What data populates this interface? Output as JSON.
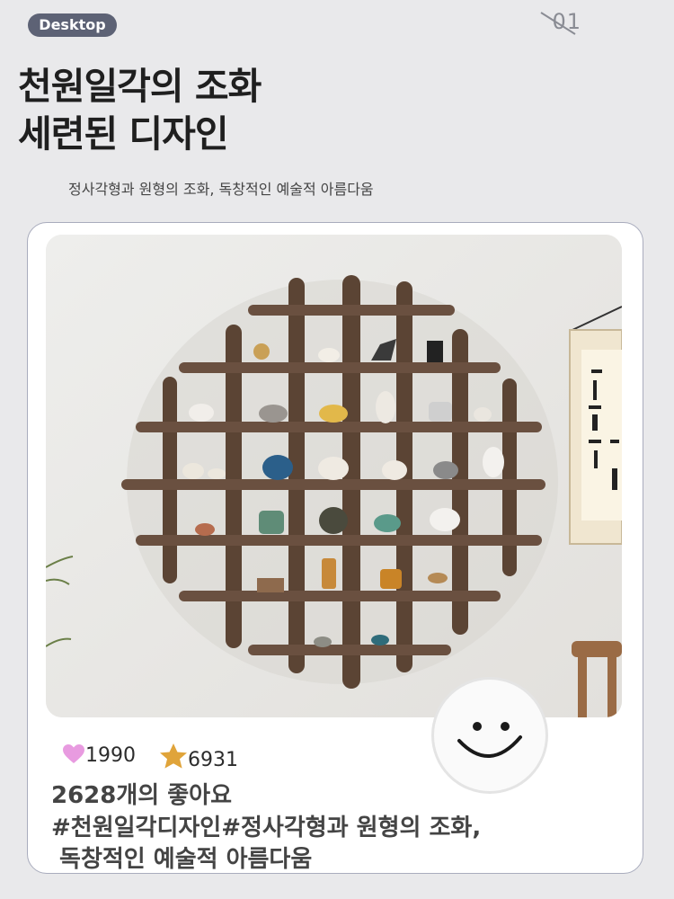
{
  "badge": {
    "label": "Desktop"
  },
  "page_number": "01",
  "headline": {
    "line1": "천원일각의 조화",
    "line2": "세련된 디자인"
  },
  "subheadline": "정사각형과 원형의 조화, 독창적인 예술적 아름다움",
  "post": {
    "hearts": "1990",
    "stars": "6931",
    "likes_text": "2628개의 좋아요",
    "hashtags_line1": "#천원일각디자인#정사각형과 원형의 조화,",
    "hashtags_line2": " 독창적인 예술적 아름다움"
  },
  "colors": {
    "badge_bg": "#5d6275",
    "heart": "#e89be0",
    "star": "#e0a43a",
    "shelf_wood": "#5b4434",
    "card_border": "#a9acbd"
  },
  "icons": {
    "heart": "heart-icon",
    "star": "star-icon",
    "smiley": "smiley-face-icon"
  }
}
